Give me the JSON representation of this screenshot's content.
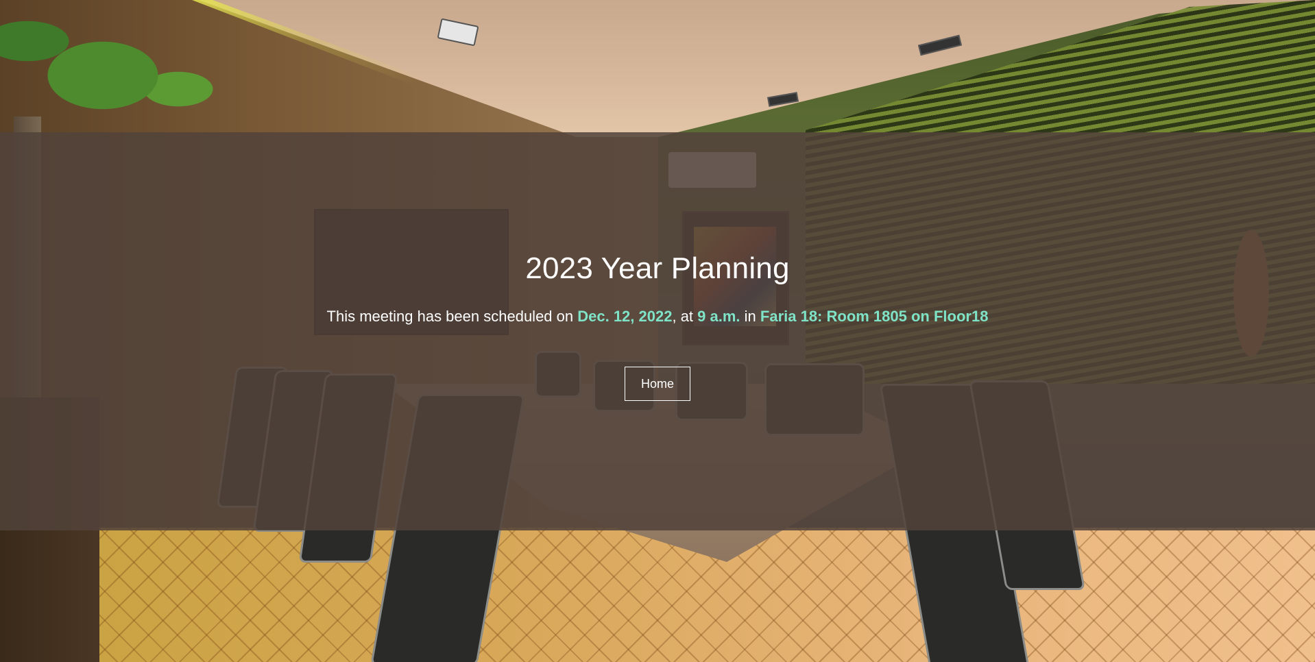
{
  "meeting": {
    "title": "2023 Year Planning",
    "message_prefix": "This meeting has been scheduled on ",
    "date": "Dec. 12, 2022",
    "sep_time": ", at ",
    "time": "9 a.m.",
    "sep_location": " in ",
    "location": "Faria 18: Room 1805 on Floor18"
  },
  "actions": {
    "home_label": "Home"
  },
  "colors": {
    "highlight": "#7fe3c8",
    "overlay": "#52423a",
    "text": "#ffffff"
  }
}
